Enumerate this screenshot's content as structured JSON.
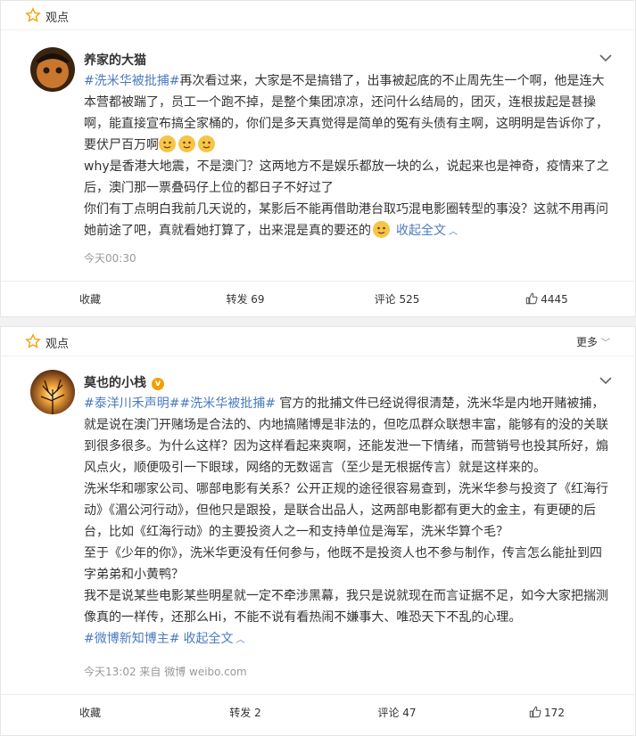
{
  "posts": [
    {
      "section_label": "观点",
      "more_label": "",
      "username": "养家的大猫",
      "verified": false,
      "paragraphs": [
        {
          "hashtags": [
            "#洗米华被批捕#"
          ],
          "text": "再次看过来，大家是不是搞错了，出事被起底的不止周先生一个啊，他是连大本营都被踹了，员工一个跑不掉，是整个集团凉凉，还问什么结局的，团灭，连根拔起是甚操啊，能直接宣布搞全家桶的，你们是多天真觉得是简单的冤有头债有主啊，这明明是告诉你了，要伏尸百万啊",
          "emojis": 3
        },
        {
          "text": "why是香港大地震，不是澳门？这两地方不是娱乐都放一块的么，说起来也是神奇，疫情来了之后，澳门那一票叠码仔上位的都日子不好过了"
        },
        {
          "text": "你们有丁点明白我前几天说的，某影后不能再借助港台取巧混电影圈转型的事没？这就不用再问她前途了吧，真就看她打算了，出来混是真的要还的",
          "expand": "收起全文"
        }
      ],
      "meta": "今天00:30",
      "actions": {
        "collect": "收藏",
        "repost": "转发 69",
        "comment": "评论 525",
        "like": "4445"
      }
    },
    {
      "section_label": "观点",
      "more_label": "更多",
      "username": "莫也的小栈",
      "verified": true,
      "paragraphs": [
        {
          "hashtags": [
            "#泰洋川禾声明#",
            "#洗米华被批捕#"
          ],
          "text": " 官方的批捕文件已经说得很清楚，洗米华是内地开赌被捕，就是说在澳门开赌场是合法的、内地搞赌博是非法的，但吃瓜群众联想丰富，能够有的没的关联到很多很多。为什么这样？因为这样看起来爽啊，还能发泄一下情绪，而营销号也投其所好，煽风点火，顺便吸引一下眼球，网络的无数谣言（至少是无根据传言）就是这样来的。"
        },
        {
          "text": "洗米华和哪家公司、哪部电影有关系？公开正规的途径很容易查到，洗米华参与投资了《红海行动》《湄公河行动》，但他只是跟投，是联合出品人，这两部电影都有更大的金主，有更硬的后台，比如《红海行动》的主要投资人之一和支持单位是海军，洗米华算个毛？"
        },
        {
          "text": "至于《少年的你》，洗米华更没有任何参与，他既不是投资人也不参与制作，传言怎么能扯到四字弟弟和小黄鸭？"
        },
        {
          "text": "我不是说某些电影某些明星就一定不牵涉黑幕，我只是说就现在而言证据不足，如今大家把揣测像真的一样传，还那么Hi，不能不说有看热闹不嫌事大、唯恐天下不乱的心理。"
        },
        {
          "hashtags": [
            "#微博新知博主#"
          ],
          "text": "",
          "expand": "收起全文"
        }
      ],
      "meta": "今天13:02  来自 微博 weibo.com",
      "actions": {
        "collect": "收藏",
        "repost": "转发 2",
        "comment": "评论 47",
        "like": "172"
      }
    }
  ],
  "colors": {
    "link": "#4a7bbf",
    "meta": "#999999",
    "star": "#f0a000"
  }
}
